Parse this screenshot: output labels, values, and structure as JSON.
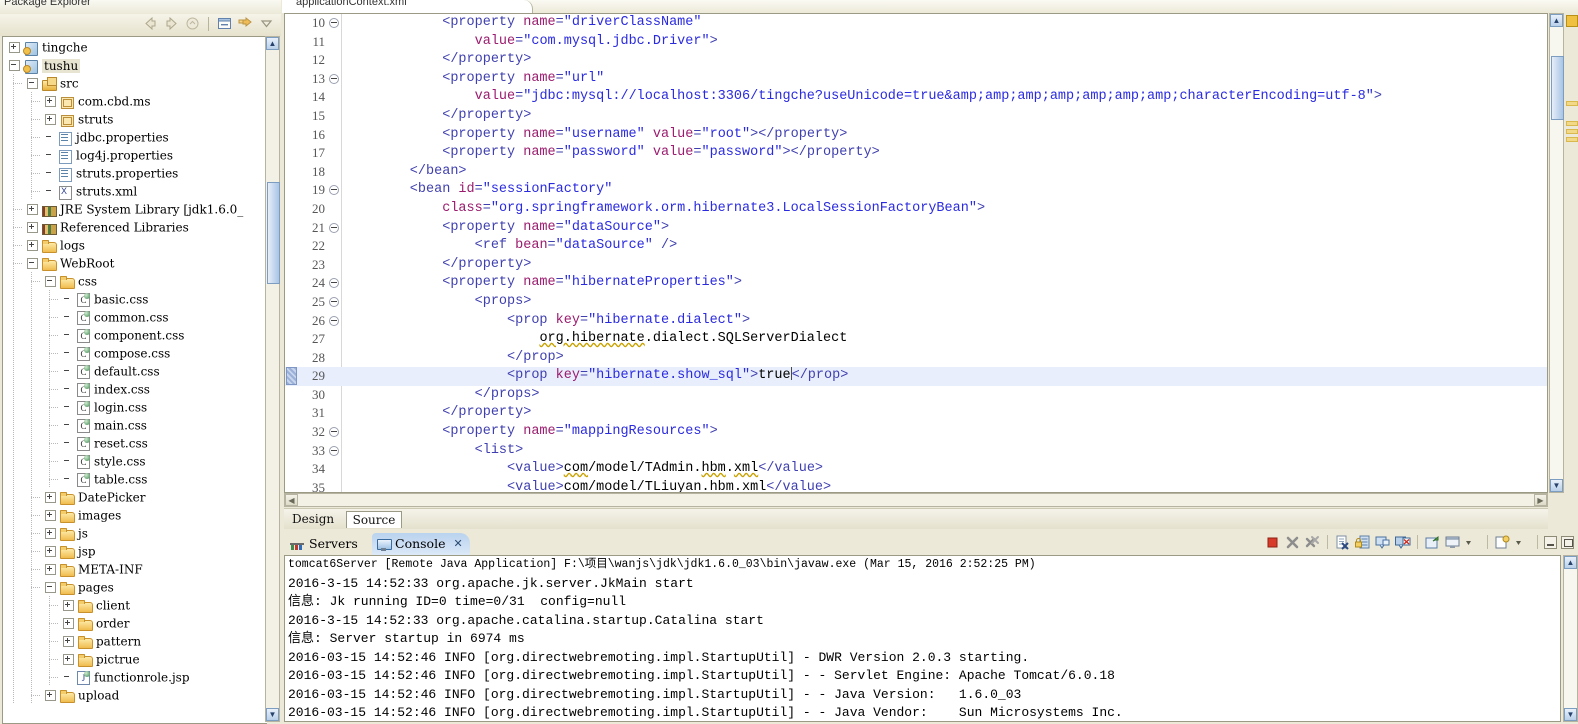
{
  "explorer": {
    "tab_label": "Package Explorer",
    "toolbar_icons": [
      "back-arrow-icon",
      "forward-arrow-icon",
      "home-icon",
      "collapse-all-icon",
      "link-with-editor-icon",
      "view-menu-icon"
    ],
    "tree": [
      {
        "depth": 0,
        "label": "tingche",
        "icon": "project-icon",
        "expander": "plus",
        "selected": false
      },
      {
        "depth": 0,
        "label": "tushu",
        "icon": "project-icon",
        "expander": "minus",
        "selected": true
      },
      {
        "depth": 1,
        "label": "src",
        "icon": "source-folder-icon",
        "expander": "minus",
        "selected": false
      },
      {
        "depth": 2,
        "label": "com.cbd.ms",
        "icon": "package-icon",
        "expander": "plus",
        "selected": false
      },
      {
        "depth": 2,
        "label": "struts",
        "icon": "package-icon",
        "expander": "plus",
        "selected": false
      },
      {
        "depth": 2,
        "label": "jdbc.properties",
        "icon": "properties-file-icon",
        "expander": "none",
        "selected": false
      },
      {
        "depth": 2,
        "label": "log4j.properties",
        "icon": "properties-file-icon",
        "expander": "none",
        "selected": false
      },
      {
        "depth": 2,
        "label": "struts.properties",
        "icon": "properties-file-icon",
        "expander": "none",
        "selected": false
      },
      {
        "depth": 2,
        "label": "struts.xml",
        "icon": "xml-file-icon",
        "expander": "none",
        "selected": false
      },
      {
        "depth": 1,
        "label": "JRE System Library [jdk1.6.0_",
        "icon": "library-icon",
        "expander": "plus",
        "selected": false
      },
      {
        "depth": 1,
        "label": "Referenced Libraries",
        "icon": "library-icon",
        "expander": "plus",
        "selected": false
      },
      {
        "depth": 1,
        "label": "logs",
        "icon": "folder-icon",
        "expander": "plus",
        "selected": false
      },
      {
        "depth": 1,
        "label": "WebRoot",
        "icon": "folder-icon",
        "expander": "minus",
        "selected": false
      },
      {
        "depth": 2,
        "label": "css",
        "icon": "folder-icon",
        "expander": "minus",
        "selected": false
      },
      {
        "depth": 3,
        "label": "basic.css",
        "icon": "css-file-icon",
        "expander": "none",
        "selected": false
      },
      {
        "depth": 3,
        "label": "common.css",
        "icon": "css-file-icon",
        "expander": "none",
        "selected": false
      },
      {
        "depth": 3,
        "label": "component.css",
        "icon": "css-file-icon",
        "expander": "none",
        "selected": false
      },
      {
        "depth": 3,
        "label": "compose.css",
        "icon": "css-file-icon",
        "expander": "none",
        "selected": false
      },
      {
        "depth": 3,
        "label": "default.css",
        "icon": "css-file-icon",
        "expander": "none",
        "selected": false
      },
      {
        "depth": 3,
        "label": "index.css",
        "icon": "css-file-icon",
        "expander": "none",
        "selected": false
      },
      {
        "depth": 3,
        "label": "login.css",
        "icon": "css-file-icon",
        "expander": "none",
        "selected": false
      },
      {
        "depth": 3,
        "label": "main.css",
        "icon": "css-file-icon",
        "expander": "none",
        "selected": false
      },
      {
        "depth": 3,
        "label": "reset.css",
        "icon": "css-file-icon",
        "expander": "none",
        "selected": false
      },
      {
        "depth": 3,
        "label": "style.css",
        "icon": "css-file-icon",
        "expander": "none",
        "selected": false
      },
      {
        "depth": 3,
        "label": "table.css",
        "icon": "css-file-icon",
        "expander": "none",
        "selected": false
      },
      {
        "depth": 2,
        "label": "DatePicker",
        "icon": "folder-icon",
        "expander": "plus",
        "selected": false
      },
      {
        "depth": 2,
        "label": "images",
        "icon": "folder-icon",
        "expander": "plus",
        "selected": false
      },
      {
        "depth": 2,
        "label": "js",
        "icon": "folder-icon",
        "expander": "plus",
        "selected": false
      },
      {
        "depth": 2,
        "label": "jsp",
        "icon": "folder-icon",
        "expander": "plus",
        "selected": false
      },
      {
        "depth": 2,
        "label": "META-INF",
        "icon": "folder-icon",
        "expander": "plus",
        "selected": false
      },
      {
        "depth": 2,
        "label": "pages",
        "icon": "folder-icon",
        "expander": "minus",
        "selected": false
      },
      {
        "depth": 3,
        "label": "client",
        "icon": "folder-icon",
        "expander": "plus",
        "selected": false
      },
      {
        "depth": 3,
        "label": "order",
        "icon": "folder-icon",
        "expander": "plus",
        "selected": false
      },
      {
        "depth": 3,
        "label": "pattern",
        "icon": "folder-icon",
        "expander": "plus",
        "selected": false
      },
      {
        "depth": 3,
        "label": "pictrue",
        "icon": "folder-icon",
        "expander": "plus",
        "selected": false
      },
      {
        "depth": 3,
        "label": "functionrole.jsp",
        "icon": "jsp-file-icon",
        "expander": "none",
        "selected": false
      },
      {
        "depth": 2,
        "label": "upload",
        "icon": "folder-icon",
        "expander": "plus",
        "selected": false
      }
    ]
  },
  "editor": {
    "tab_label": "applicationContext.xml",
    "bottom_tabs": [
      {
        "label": "Design",
        "active": false
      },
      {
        "label": "Source",
        "active": true
      }
    ],
    "lines": [
      {
        "num": "10",
        "fold": true,
        "hl": false,
        "parts": [
          {
            "t": "            <property ",
            "c": "tagp"
          },
          {
            "t": "name",
            "c": "aname"
          },
          {
            "t": "=",
            "c": "tagp"
          },
          {
            "t": "\"driverClassName\"",
            "c": "aval"
          }
        ]
      },
      {
        "num": "11",
        "fold": false,
        "hl": false,
        "parts": [
          {
            "t": "                ",
            "c": "ptxt"
          },
          {
            "t": "value",
            "c": "aname"
          },
          {
            "t": "=",
            "c": "tagp"
          },
          {
            "t": "\"com.mysql.jdbc.Driver\"",
            "c": "aval"
          },
          {
            "t": ">",
            "c": "tagp"
          }
        ]
      },
      {
        "num": "12",
        "fold": false,
        "hl": false,
        "parts": [
          {
            "t": "            </property>",
            "c": "tagp"
          }
        ]
      },
      {
        "num": "13",
        "fold": true,
        "hl": false,
        "parts": [
          {
            "t": "            <property ",
            "c": "tagp"
          },
          {
            "t": "name",
            "c": "aname"
          },
          {
            "t": "=",
            "c": "tagp"
          },
          {
            "t": "\"url\"",
            "c": "aval"
          }
        ]
      },
      {
        "num": "14",
        "fold": false,
        "hl": false,
        "parts": [
          {
            "t": "                ",
            "c": "ptxt"
          },
          {
            "t": "value",
            "c": "aname"
          },
          {
            "t": "=",
            "c": "tagp"
          },
          {
            "t": "\"jdbc:mysql://localhost:3306/tingche?useUnicode=true&amp;amp;amp;amp;amp;amp;amp;characterEncoding=utf-8\"",
            "c": "aval"
          },
          {
            "t": ">",
            "c": "tagp"
          }
        ]
      },
      {
        "num": "15",
        "fold": false,
        "hl": false,
        "parts": [
          {
            "t": "            </property>",
            "c": "tagp"
          }
        ]
      },
      {
        "num": "16",
        "fold": false,
        "hl": false,
        "parts": [
          {
            "t": "            <property ",
            "c": "tagp"
          },
          {
            "t": "name",
            "c": "aname"
          },
          {
            "t": "=",
            "c": "tagp"
          },
          {
            "t": "\"username\" ",
            "c": "aval"
          },
          {
            "t": "value",
            "c": "aname"
          },
          {
            "t": "=",
            "c": "tagp"
          },
          {
            "t": "\"root\"",
            "c": "aval"
          },
          {
            "t": "></property>",
            "c": "tagp"
          }
        ]
      },
      {
        "num": "17",
        "fold": false,
        "hl": false,
        "parts": [
          {
            "t": "            <property ",
            "c": "tagp"
          },
          {
            "t": "name",
            "c": "aname"
          },
          {
            "t": "=",
            "c": "tagp"
          },
          {
            "t": "\"password\" ",
            "c": "aval"
          },
          {
            "t": "value",
            "c": "aname"
          },
          {
            "t": "=",
            "c": "tagp"
          },
          {
            "t": "\"password\"",
            "c": "aval"
          },
          {
            "t": "></property>",
            "c": "tagp"
          }
        ]
      },
      {
        "num": "18",
        "fold": false,
        "hl": false,
        "parts": [
          {
            "t": "        </bean>",
            "c": "tagp"
          }
        ]
      },
      {
        "num": "19",
        "fold": true,
        "hl": false,
        "parts": [
          {
            "t": "        <bean ",
            "c": "tagp"
          },
          {
            "t": "id",
            "c": "aname"
          },
          {
            "t": "=",
            "c": "tagp"
          },
          {
            "t": "\"sessionFactory\"",
            "c": "aval"
          }
        ]
      },
      {
        "num": "20",
        "fold": false,
        "hl": false,
        "parts": [
          {
            "t": "            ",
            "c": "ptxt"
          },
          {
            "t": "class",
            "c": "aname"
          },
          {
            "t": "=",
            "c": "tagp"
          },
          {
            "t": "\"org.springframework.orm.hibernate3.LocalSessionFactoryBean\"",
            "c": "aval"
          },
          {
            "t": ">",
            "c": "tagp"
          }
        ]
      },
      {
        "num": "21",
        "fold": true,
        "hl": false,
        "parts": [
          {
            "t": "            <property ",
            "c": "tagp"
          },
          {
            "t": "name",
            "c": "aname"
          },
          {
            "t": "=",
            "c": "tagp"
          },
          {
            "t": "\"dataSource\"",
            "c": "aval"
          },
          {
            "t": ">",
            "c": "tagp"
          }
        ]
      },
      {
        "num": "22",
        "fold": false,
        "hl": false,
        "parts": [
          {
            "t": "                <ref ",
            "c": "tagp"
          },
          {
            "t": "bean",
            "c": "aname"
          },
          {
            "t": "=",
            "c": "tagp"
          },
          {
            "t": "\"dataSource\" ",
            "c": "aval"
          },
          {
            "t": "/>",
            "c": "tagp"
          }
        ]
      },
      {
        "num": "23",
        "fold": false,
        "hl": false,
        "parts": [
          {
            "t": "            </property>",
            "c": "tagp"
          }
        ]
      },
      {
        "num": "24",
        "fold": true,
        "hl": false,
        "parts": [
          {
            "t": "            <property ",
            "c": "tagp"
          },
          {
            "t": "name",
            "c": "aname"
          },
          {
            "t": "=",
            "c": "tagp"
          },
          {
            "t": "\"hibernateProperties\"",
            "c": "aval"
          },
          {
            "t": ">",
            "c": "tagp"
          }
        ]
      },
      {
        "num": "25",
        "fold": true,
        "hl": false,
        "parts": [
          {
            "t": "                <props>",
            "c": "tagp"
          }
        ]
      },
      {
        "num": "26",
        "fold": true,
        "hl": false,
        "parts": [
          {
            "t": "                    <prop ",
            "c": "tagp"
          },
          {
            "t": "key",
            "c": "aname"
          },
          {
            "t": "=",
            "c": "tagp"
          },
          {
            "t": "\"hibernate.dialect\"",
            "c": "aval"
          },
          {
            "t": ">",
            "c": "tagp"
          }
        ]
      },
      {
        "num": "27",
        "fold": false,
        "hl": false,
        "parts": [
          {
            "t": "                        ",
            "c": "ptxt"
          },
          {
            "t": "org.hibernate",
            "c": "sqz"
          },
          {
            "t": ".dialect.SQLServerDialect",
            "c": "ptxt"
          }
        ]
      },
      {
        "num": "28",
        "fold": false,
        "hl": false,
        "parts": [
          {
            "t": "                    </prop>",
            "c": "tagp"
          }
        ]
      },
      {
        "num": "29",
        "fold": false,
        "hl": true,
        "parts": [
          {
            "t": "                    <prop ",
            "c": "tagp"
          },
          {
            "t": "key",
            "c": "aname"
          },
          {
            "t": "=",
            "c": "tagp"
          },
          {
            "t": "\"hibernate.show_sql\"",
            "c": "aval"
          },
          {
            "t": ">",
            "c": "tagp"
          },
          {
            "t": "true",
            "c": "ptxt"
          },
          {
            "t": "</prop>",
            "c": "tagp"
          }
        ]
      },
      {
        "num": "30",
        "fold": false,
        "hl": false,
        "parts": [
          {
            "t": "                </props>",
            "c": "tagp"
          }
        ]
      },
      {
        "num": "31",
        "fold": false,
        "hl": false,
        "parts": [
          {
            "t": "            </property>",
            "c": "tagp"
          }
        ]
      },
      {
        "num": "32",
        "fold": true,
        "hl": false,
        "parts": [
          {
            "t": "            <property ",
            "c": "tagp"
          },
          {
            "t": "name",
            "c": "aname"
          },
          {
            "t": "=",
            "c": "tagp"
          },
          {
            "t": "\"mappingResources\"",
            "c": "aval"
          },
          {
            "t": ">",
            "c": "tagp"
          }
        ]
      },
      {
        "num": "33",
        "fold": true,
        "hl": false,
        "parts": [
          {
            "t": "                <list>",
            "c": "tagp"
          }
        ]
      },
      {
        "num": "34",
        "fold": false,
        "hl": false,
        "parts": [
          {
            "t": "                    <value>",
            "c": "tagp"
          },
          {
            "t": "com",
            "c": "sqz"
          },
          {
            "t": "/model/TAdmin.",
            "c": "ptxt"
          },
          {
            "t": "hbm",
            "c": "sqz"
          },
          {
            "t": ".",
            "c": "ptxt"
          },
          {
            "t": "xml",
            "c": "sqz"
          },
          {
            "t": "</value>",
            "c": "tagp"
          }
        ]
      },
      {
        "num": "35",
        "fold": false,
        "hl": false,
        "parts": [
          {
            "t": "                    <value>",
            "c": "tagp"
          },
          {
            "t": "com/model/TLiuyan.hbm.xml",
            "c": "ptxt"
          },
          {
            "t": "</value>",
            "c": "tagp"
          }
        ]
      }
    ]
  },
  "console": {
    "tabs": [
      {
        "label": "Servers",
        "icon": "servers-icon",
        "active": false,
        "close": false
      },
      {
        "label": "Console",
        "icon": "console-icon",
        "active": true,
        "close": true
      }
    ],
    "toolbar_icons": [
      "terminate-icon",
      "remove-launch-icon",
      "remove-all-launches-icon",
      "clear-console-icon",
      "scroll-lock-icon",
      "pin-console-icon",
      "display-selected-console-icon",
      "open-console-icon",
      "new-console-view-icon",
      "view-menu-icon",
      "minimize-icon",
      "maximize-icon"
    ],
    "process_header": "tomcat6Server [Remote Java Application] F:\\项目\\wanjs\\jdk\\jdk1.6.0_03\\bin\\javaw.exe (Mar 15, 2016 2:52:25 PM)",
    "lines": [
      "2016-3-15 14:52:33 org.apache.jk.server.JkMain start",
      "信息: Jk running ID=0 time=0/31  config=null",
      "2016-3-15 14:52:33 org.apache.catalina.startup.Catalina start",
      "信息: Server startup in 6974 ms",
      "2016-03-15 14:52:46 INFO [org.directwebremoting.impl.StartupUtil] - DWR Version 2.0.3 starting.",
      "2016-03-15 14:52:46 INFO [org.directwebremoting.impl.StartupUtil] - - Servlet Engine: Apache Tomcat/6.0.18",
      "2016-03-15 14:52:46 INFO [org.directwebremoting.impl.StartupUtil] - - Java Version:   1.6.0_03",
      "2016-03-15 14:52:46 INFO [org.directwebremoting.impl.StartupUtil] - - Java Vendor:    Sun Microsystems Inc."
    ]
  },
  "colors": {
    "chrome": "#ece9d8",
    "tag": "#3f3fb0",
    "attr_name": "#9b1b6e",
    "attr_value": "#2a2ae0",
    "selected_line": "#e8eefc",
    "active_tab": "#b9d2ee"
  }
}
